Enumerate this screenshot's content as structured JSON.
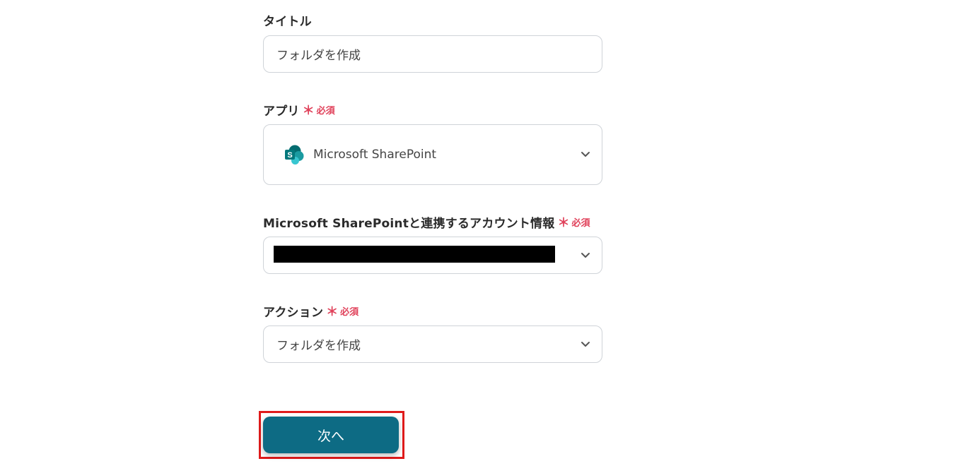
{
  "title_field": {
    "label": "タイトル",
    "value": "フォルダを作成"
  },
  "app_field": {
    "label": "アプリ",
    "required_mark": "＊",
    "required_text": "必須",
    "value": "Microsoft SharePoint",
    "icon": "sharepoint-logo-icon"
  },
  "account_field": {
    "label": "Microsoft SharePointと連携するアカウント情報",
    "required_mark": "＊",
    "required_text": "必須",
    "value_redacted": true
  },
  "action_field": {
    "label": "アクション",
    "required_mark": "＊",
    "required_text": "必須",
    "value": "フォルダを作成"
  },
  "next_button": {
    "label": "次へ"
  },
  "colors": {
    "primary_button": "#0d6b84",
    "required": "#e0415a",
    "highlight_frame": "#e01b1b",
    "field_border": "#cfd3d8"
  }
}
